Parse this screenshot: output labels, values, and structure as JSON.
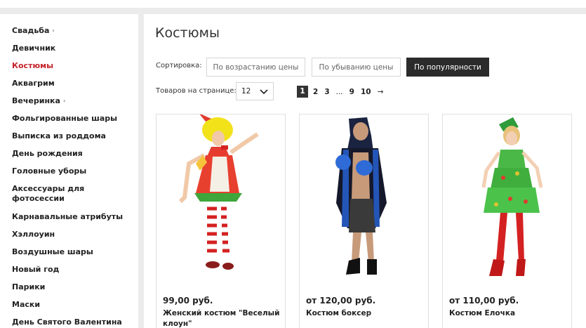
{
  "sidebar": {
    "items": [
      {
        "label": "Свадьба",
        "arrow": "›"
      },
      {
        "label": "Девичник"
      },
      {
        "label": "Костюмы"
      },
      {
        "label": "Аквагрим"
      },
      {
        "label": "Вечеринка",
        "arrow": "›"
      },
      {
        "label": "Фольгированные шары"
      },
      {
        "label": "Выписка из роддома"
      },
      {
        "label": "День рождения"
      },
      {
        "label": "Головные уборы"
      },
      {
        "label": "Аксессуары для фотосессии"
      },
      {
        "label": "Карнавальные атрибуты"
      },
      {
        "label": "Хэллоуин"
      },
      {
        "label": "Воздушные шары"
      },
      {
        "label": "Новый год"
      },
      {
        "label": "Парики"
      },
      {
        "label": "Маски"
      },
      {
        "label": "День Святого Валентина"
      }
    ],
    "active_color": "#c4222a"
  },
  "main": {
    "title": "Костюмы",
    "sort": {
      "label": "Сортировка:",
      "options": [
        "По возрастанию цены",
        "По убыванию цены",
        "По популярности"
      ],
      "selected": "По популярности"
    },
    "per_page": {
      "label": "Товаров на странице:",
      "value": "12"
    },
    "pagination": {
      "current": "1",
      "pages": [
        "2",
        "3",
        "...",
        "9",
        "10"
      ],
      "next": "→"
    },
    "products": [
      {
        "price": "99,00 руб.",
        "name": "Женский костюм \"Веселый клоун\""
      },
      {
        "price": "от 120,00 руб.",
        "name": "Костюм боксер"
      },
      {
        "price": "от 110,00 руб.",
        "name": "Костюм Елочка"
      }
    ]
  }
}
